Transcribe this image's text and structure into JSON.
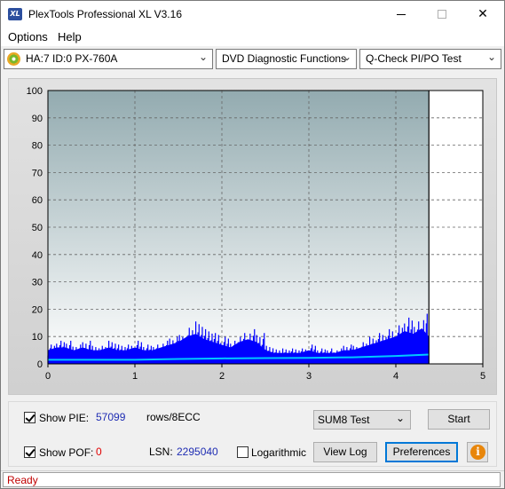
{
  "window": {
    "title": "PlexTools Professional XL V3.16",
    "app_icon_text": "XL"
  },
  "menu": {
    "options": "Options",
    "help": "Help"
  },
  "toolbar": {
    "drive": "HA:7 ID:0  PX-760A",
    "function": "DVD Diagnostic Functions",
    "test": "Q-Check PI/PO Test"
  },
  "chart_data": {
    "type": "area",
    "x_ticks": [
      "0",
      "1",
      "2",
      "3",
      "4",
      "5"
    ],
    "y_ticks": [
      "0",
      "10",
      "20",
      "30",
      "40",
      "50",
      "60",
      "70",
      "80",
      "90",
      "100"
    ],
    "xlim": [
      0,
      5
    ],
    "ylim": [
      0,
      100
    ],
    "grid": true,
    "end_marker_x": 4.38,
    "series": [
      {
        "color": "#0000ff",
        "x": [
          0.0,
          0.1,
          0.2,
          0.3,
          0.4,
          0.5,
          0.6,
          0.7,
          0.8,
          0.9,
          1.0,
          1.1,
          1.2,
          1.3,
          1.4,
          1.5,
          1.6,
          1.7,
          1.8,
          1.9,
          2.0,
          2.1,
          2.2,
          2.3,
          2.4,
          2.5,
          2.6,
          2.7,
          2.8,
          2.9,
          3.0,
          3.1,
          3.2,
          3.3,
          3.4,
          3.5,
          3.6,
          3.7,
          3.8,
          3.9,
          4.0,
          4.1,
          4.2,
          4.3,
          4.38
        ],
        "values": [
          5,
          6,
          6,
          5,
          6,
          5,
          5,
          6,
          5,
          5,
          6,
          5,
          5,
          6,
          7,
          8,
          10,
          11,
          9,
          8,
          7,
          6,
          8,
          9,
          8,
          5,
          4,
          4,
          4,
          4,
          5,
          4,
          4,
          4,
          5,
          5,
          6,
          7,
          8,
          9,
          10,
          12,
          11,
          13,
          10
        ]
      },
      {
        "color": "#00c8ff",
        "x": [
          0.0,
          0.5,
          1.0,
          1.5,
          2.0,
          2.5,
          3.0,
          3.5,
          4.0,
          4.38
        ],
        "values": [
          1.5,
          1.5,
          1.5,
          1.8,
          2.0,
          2.1,
          2.2,
          2.4,
          2.9,
          3.4
        ]
      }
    ]
  },
  "stats": {
    "show_pie_label": "Show PIE:",
    "pie_value": "57099",
    "rows_label": "rows/8ECC",
    "show_poe_label": "Show POF:",
    "poe_value": "0",
    "lsn_label": "LSN:",
    "lsn_value": "2295040",
    "logarithmic_label": "Logarithmic"
  },
  "controls": {
    "sum_test": "SUM8 Test",
    "start": "Start",
    "view_log": "View Log",
    "preferences": "Preferences",
    "info_glyph": "i"
  },
  "status": {
    "text": "Ready"
  }
}
